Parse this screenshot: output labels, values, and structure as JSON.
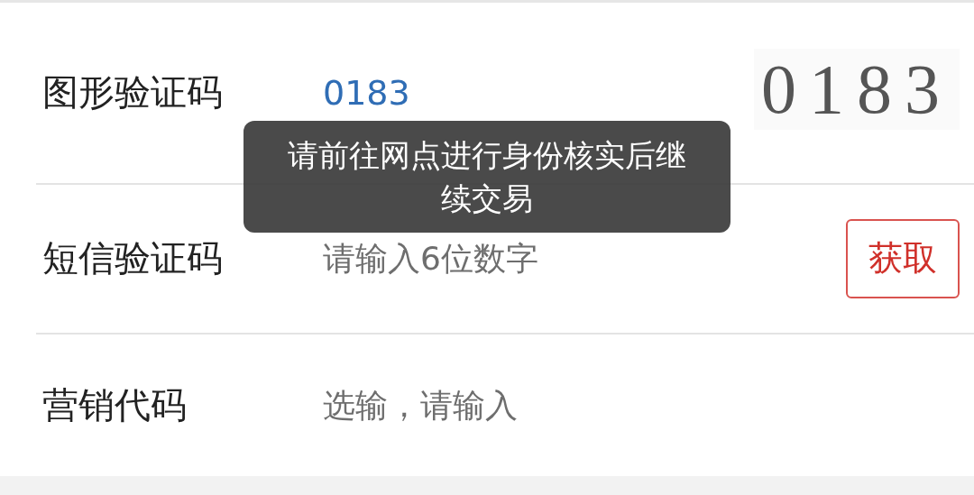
{
  "form": {
    "rows": [
      {
        "kind": "captcha",
        "label": "图形验证码",
        "value": "0183",
        "captcha": "0183"
      },
      {
        "kind": "sms",
        "label": "短信验证码",
        "placeholder": "请输入6位数字",
        "button": "获取"
      },
      {
        "kind": "plain",
        "label": "营销代码",
        "placeholder": "选输，请输入"
      }
    ]
  },
  "toast": {
    "message": "请前往网点进行身份核实后继续交易"
  }
}
